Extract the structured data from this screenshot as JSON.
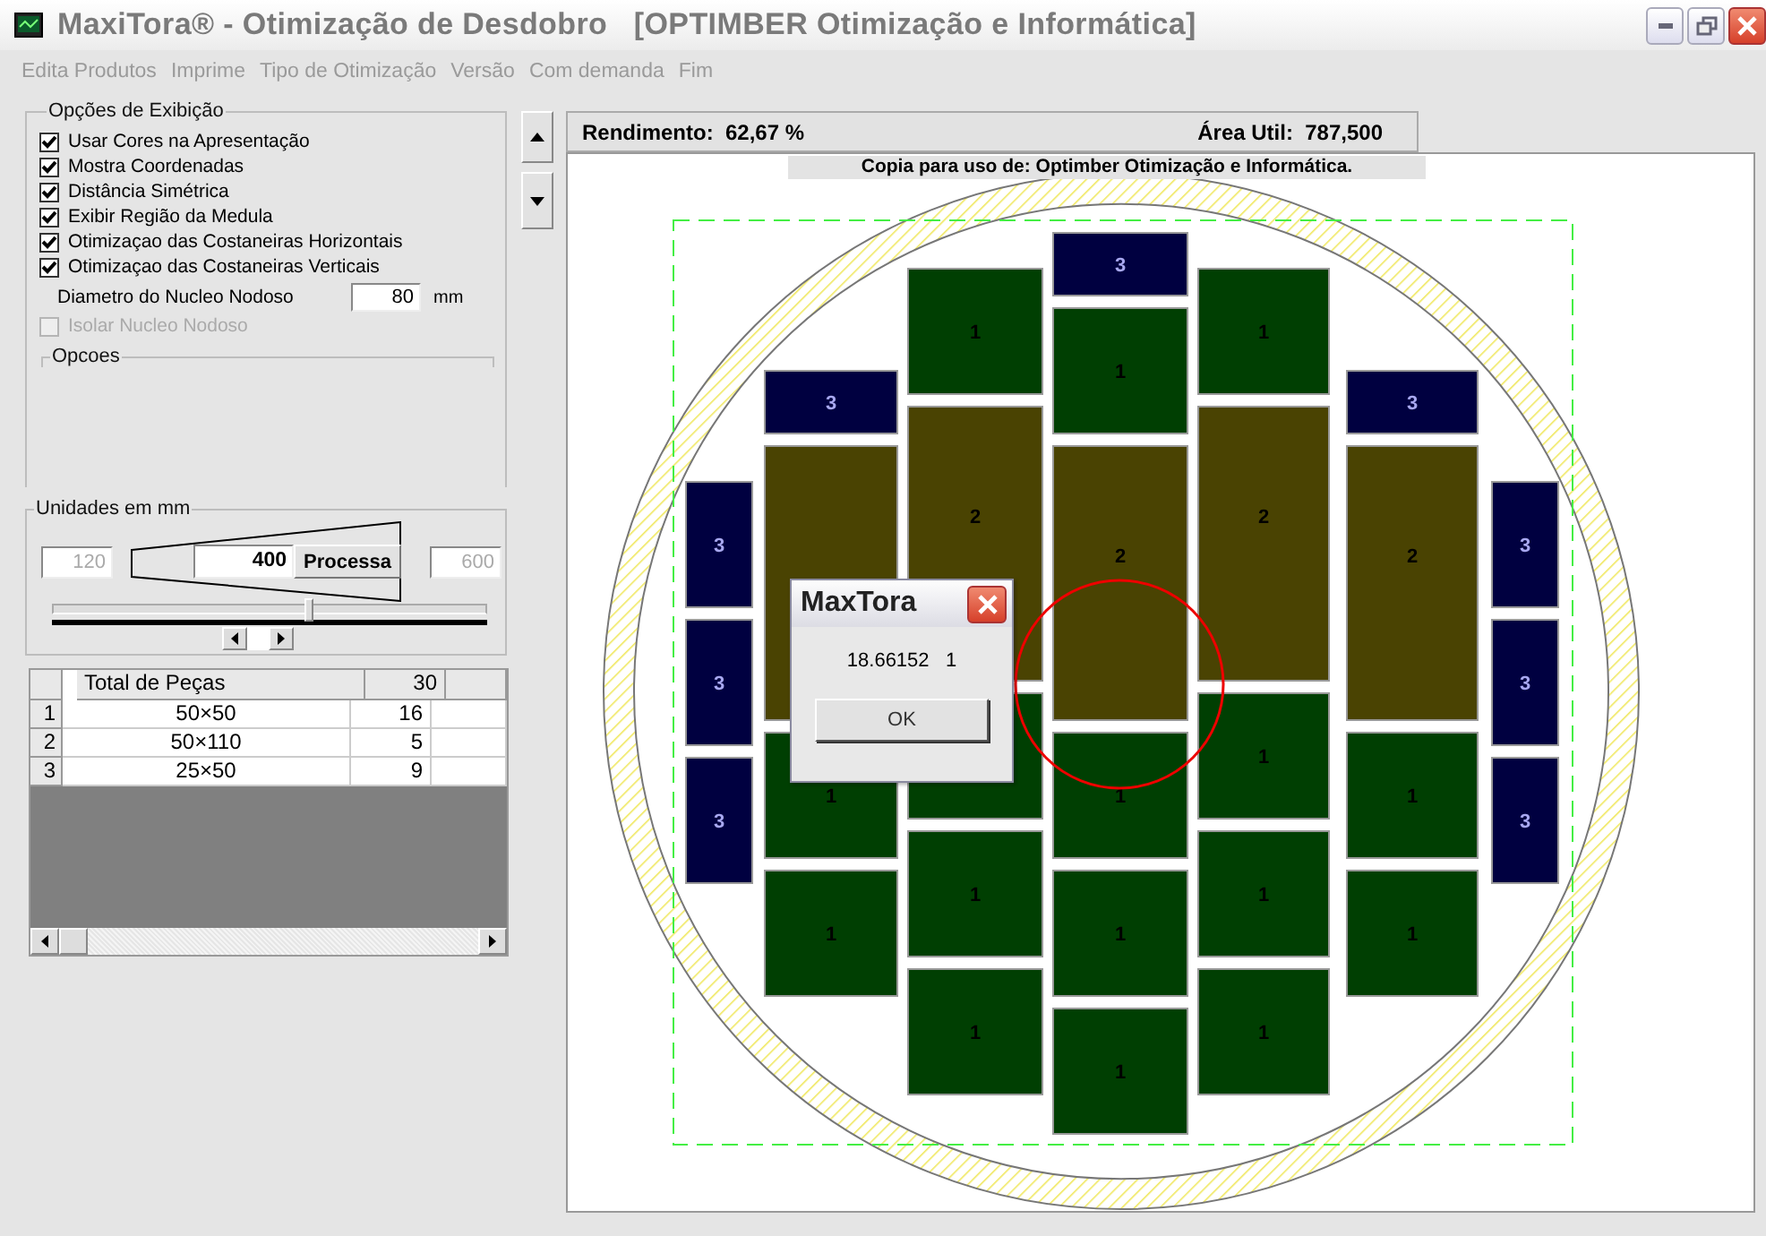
{
  "window": {
    "title": "MaxiTora® - Otimização de Desdobro   [OPTIMBER Otimização e Informática]"
  },
  "menu": [
    "Edita Produtos",
    "Imprime",
    "Tipo de Otimização",
    "Versão",
    "Com demanda",
    "Fim"
  ],
  "display_options": {
    "title": "Opções de Exibição",
    "checkboxes": [
      {
        "label": "Usar Cores na Apresentação",
        "checked": true,
        "disabled": false
      },
      {
        "label": "Mostra Coordenadas",
        "checked": true,
        "disabled": false
      },
      {
        "label": "Distância Simétrica",
        "checked": true,
        "disabled": false
      },
      {
        "label": "Exibir Região da Medula",
        "checked": true,
        "disabled": false
      },
      {
        "label": "Otimizaçao das Costaneiras Horizontais",
        "checked": true,
        "disabled": false
      },
      {
        "label": "Otimizaçao das Costaneiras Verticais",
        "checked": true,
        "disabled": false
      }
    ],
    "diameter": {
      "label": "Diametro do Nucleo Nodoso",
      "value": "80",
      "unit": "mm"
    },
    "isolate": {
      "label": "Isolar Nucleo Nodoso",
      "checked": false,
      "disabled": true
    },
    "options_group": {
      "title": "Opcoes"
    }
  },
  "units": {
    "title": "Unidades em mm",
    "min": "120",
    "value": "400",
    "button": "Processa",
    "max": "600",
    "level": 0.59
  },
  "table": {
    "columns": [
      "Total de Peças",
      "30"
    ],
    "rows": [
      {
        "index": "1",
        "size": "50×50",
        "count": "16"
      },
      {
        "index": "2",
        "size": "50×110",
        "count": "5"
      },
      {
        "index": "3",
        "size": "25×50",
        "count": "9"
      }
    ]
  },
  "stats": [
    {
      "label": "Rendimento:",
      "value": "62,67 %"
    },
    {
      "label": "Área Util:",
      "value": "787,500"
    }
  ],
  "canvas": {
    "copy_notice": "Copia para uso de: Optimber Otimização e Informática.",
    "columns": [
      [
        {
          "kind": "strip_v",
          "label": "3"
        },
        {
          "kind": "strip_v",
          "label": "3"
        },
        {
          "kind": "strip_v",
          "label": "3"
        }
      ],
      [
        {
          "kind": "strip_h",
          "label": "3"
        },
        {
          "kind": "long"
        },
        {
          "kind": "square",
          "label": "1"
        },
        {
          "kind": "square",
          "label": "1"
        }
      ],
      [
        {
          "kind": "square",
          "label": "1"
        },
        {
          "kind": "long",
          "label": "2"
        },
        {
          "kind": "square"
        },
        {
          "kind": "square",
          "label": "1"
        },
        {
          "kind": "square",
          "label": "1"
        }
      ],
      [
        {
          "kind": "strip_h",
          "label": "3"
        },
        {
          "kind": "square",
          "label": "1"
        },
        {
          "kind": "long",
          "label": "2"
        },
        {
          "kind": "square",
          "label": "1"
        },
        {
          "kind": "square",
          "label": "1"
        },
        {
          "kind": "square",
          "label": "1"
        }
      ],
      [
        {
          "kind": "square",
          "label": "1"
        },
        {
          "kind": "long",
          "label": "2"
        },
        {
          "kind": "square",
          "label": "1"
        },
        {
          "kind": "square",
          "label": "1"
        },
        {
          "kind": "square",
          "label": "1"
        }
      ],
      [
        {
          "kind": "strip_h",
          "label": "3"
        },
        {
          "kind": "long",
          "label": "2"
        },
        {
          "kind": "square",
          "label": "1"
        },
        {
          "kind": "square",
          "label": "1"
        }
      ],
      [
        {
          "kind": "strip_v",
          "label": "3"
        },
        {
          "kind": "strip_v",
          "label": "3"
        },
        {
          "kind": "strip_v",
          "label": "3"
        }
      ]
    ]
  },
  "dialog": {
    "title": "MaxTora",
    "message": "18.66152   1",
    "button": "OK"
  }
}
